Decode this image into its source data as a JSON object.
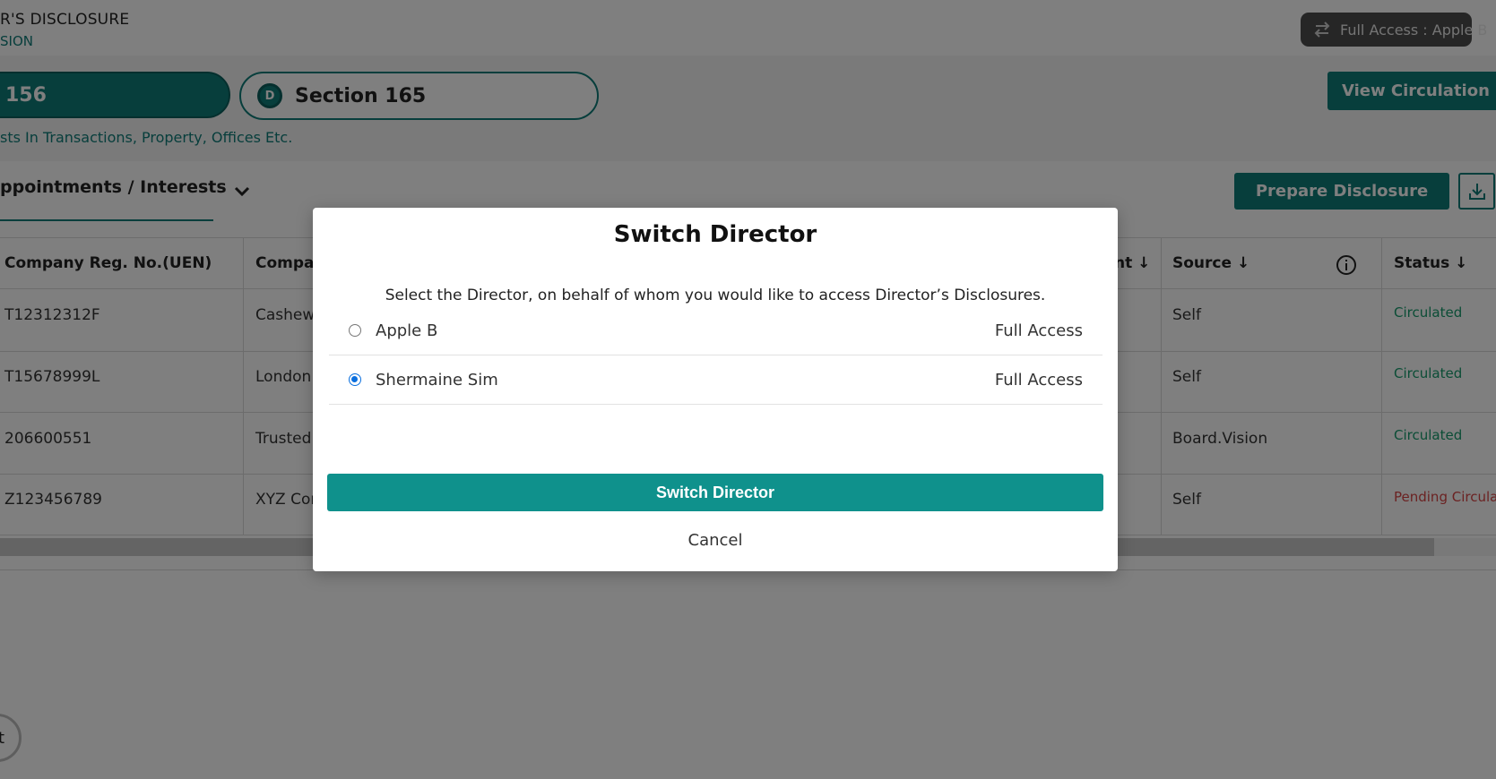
{
  "header": {
    "app_title": "R'S DISCLOSURE",
    "app_subtitle": "SION",
    "access_label": "Full Access : Apple B"
  },
  "sections": {
    "active_tab_label": "156",
    "other_tab_badge": "D",
    "other_tab_label": "Section 165",
    "description": "sts In Transactions, Property, Offices Etc.",
    "view_circulation_label": "View Circulation Histo"
  },
  "toolbar": {
    "tab_label": "ppointments / Interests",
    "prepare_label": "Prepare Disclosure"
  },
  "table": {
    "headers": {
      "uen": "Company Reg. No.(UEN)",
      "company": "Compar",
      "amount": "nt",
      "source": "Source",
      "status": "Status"
    },
    "rows": [
      {
        "uen": "T12312312F",
        "company": "Cashew",
        "source": "Self",
        "status": "Circulated"
      },
      {
        "uen": "T15678999L",
        "company": "London",
        "source": "Self",
        "status": "Circulated"
      },
      {
        "uen": "206600551",
        "company": "Trusted",
        "source": "Board.Vision",
        "status": "Circulated"
      },
      {
        "uen": "Z123456789",
        "company": "XYZ Cor",
        "source": "Self",
        "status": "Pending Circula"
      }
    ]
  },
  "floating_button_text": "t",
  "modal": {
    "title": "Switch Director",
    "description": "Select the Director, on behalf of whom you would like to access Director’s Disclosures.",
    "directors": [
      {
        "name": "Apple B",
        "access": "Full Access",
        "selected": false
      },
      {
        "name": "Shermaine Sim",
        "access": "Full Access",
        "selected": true
      }
    ],
    "switch_button": "Switch Director",
    "cancel": "Cancel"
  },
  "colors": {
    "primary": "#0f7c78",
    "button": "#0f918c",
    "status_ok": "#169a6c",
    "status_pending": "#d64545",
    "radio_selected": "#0a6fde"
  }
}
